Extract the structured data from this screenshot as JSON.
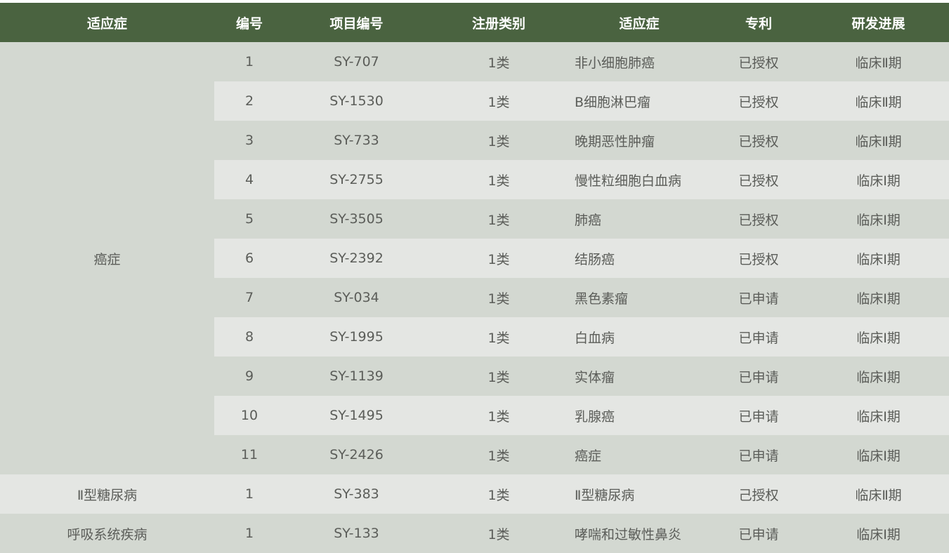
{
  "headers": [
    "适应症",
    "编号",
    "项目编号",
    "注册类别",
    "适应症",
    "专利",
    "研发进展"
  ],
  "groups": [
    {
      "name": "癌症",
      "rows": [
        {
          "no": "1",
          "code": "SY-707",
          "category": "1类",
          "indication": "非小细胞肺癌",
          "patent": "已授权",
          "progress": "临床Ⅱ期"
        },
        {
          "no": "2",
          "code": "SY-1530",
          "category": "1类",
          "indication": "B细胞淋巴瘤",
          "patent": "已授权",
          "progress": "临床Ⅱ期"
        },
        {
          "no": "3",
          "code": "SY-733",
          "category": "1类",
          "indication": "晚期恶性肿瘤",
          "patent": "已授权",
          "progress": "临床Ⅱ期"
        },
        {
          "no": "4",
          "code": "SY-2755",
          "category": "1类",
          "indication": "慢性粒细胞白血病",
          "patent": "已授权",
          "progress": "临床Ⅰ期"
        },
        {
          "no": "5",
          "code": "SY-3505",
          "category": "1类",
          "indication": "肺癌",
          "patent": "已授权",
          "progress": "临床Ⅰ期"
        },
        {
          "no": "6",
          "code": "SY-2392",
          "category": "1类",
          "indication": "结肠癌",
          "patent": "已授权",
          "progress": "临床Ⅰ期"
        },
        {
          "no": "7",
          "code": "SY-034",
          "category": "1类",
          "indication": "黑色素瘤",
          "patent": "已申请",
          "progress": "临床Ⅰ期"
        },
        {
          "no": "8",
          "code": "SY-1995",
          "category": "1类",
          "indication": "白血病",
          "patent": "已申请",
          "progress": "临床Ⅰ期"
        },
        {
          "no": "9",
          "code": "SY-1139",
          "category": "1类",
          "indication": "实体瘤",
          "patent": "已申请",
          "progress": "临床Ⅰ期"
        },
        {
          "no": "10",
          "code": "SY-1495",
          "category": "1类",
          "indication": "乳腺癌",
          "patent": "已申请",
          "progress": "临床Ⅰ期"
        },
        {
          "no": "11",
          "code": "SY-2426",
          "category": "1类",
          "indication": "癌症",
          "patent": "已申请",
          "progress": "临床Ⅰ期"
        }
      ]
    },
    {
      "name": "Ⅱ型糖尿病",
      "rows": [
        {
          "no": "1",
          "code": "SY-383",
          "category": "1类",
          "indication": "Ⅱ型糖尿病",
          "patent": "己授权",
          "progress": "临床Ⅱ期"
        }
      ]
    },
    {
      "name": "呼吸系统疾病",
      "rows": [
        {
          "no": "1",
          "code": "SY-133",
          "category": "1类",
          "indication": "哮喘和过敏性鼻炎",
          "patent": "已申请",
          "progress": "临床Ⅰ期"
        }
      ]
    }
  ],
  "colors": {
    "header_bg": "#4a6340",
    "row_dark": "#d3d8d1",
    "row_light": "#e4e6e3",
    "text": "#5b5d59"
  }
}
